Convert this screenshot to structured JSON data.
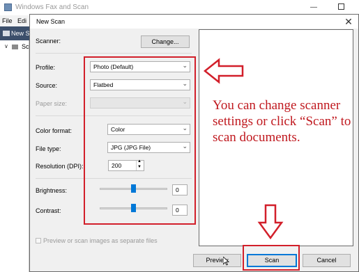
{
  "background_window": {
    "title": "Windows Fax and Scan",
    "menu": [
      "File",
      "Edi"
    ],
    "toolbar_new_scan": "New S",
    "tree_item": "Sc",
    "tree_toggle": "∨"
  },
  "dialog": {
    "title": "New Scan",
    "close_glyph": "✕",
    "scanner": {
      "label": "Scanner:",
      "change_button": "Change..."
    },
    "profile": {
      "label": "Profile:",
      "value": "Photo (Default)"
    },
    "source": {
      "label": "Source:",
      "value": "Flatbed"
    },
    "paper_size": {
      "label": "Paper size:",
      "value": ""
    },
    "color_format": {
      "label": "Color format:",
      "value": "Color"
    },
    "file_type": {
      "label": "File type:",
      "value": "JPG (JPG File)"
    },
    "resolution": {
      "label": "Resolution (DPI):",
      "value": "200"
    },
    "brightness": {
      "label": "Brightness:",
      "value": "0",
      "level_percent": 50
    },
    "contrast": {
      "label": "Contrast:",
      "value": "0",
      "level_percent": 50
    },
    "separate_files_checkbox": {
      "label": "Preview or scan images as separate files",
      "checked": false
    },
    "buttons": {
      "preview": "Preview",
      "scan": "Scan",
      "cancel": "Cancel"
    }
  },
  "annotation": {
    "text": "You can change scanner settings or click “Scan” to scan documents.",
    "color": "#c0191f"
  },
  "colors": {
    "accent": "#0078d7",
    "highlight": "#d21f2a"
  }
}
